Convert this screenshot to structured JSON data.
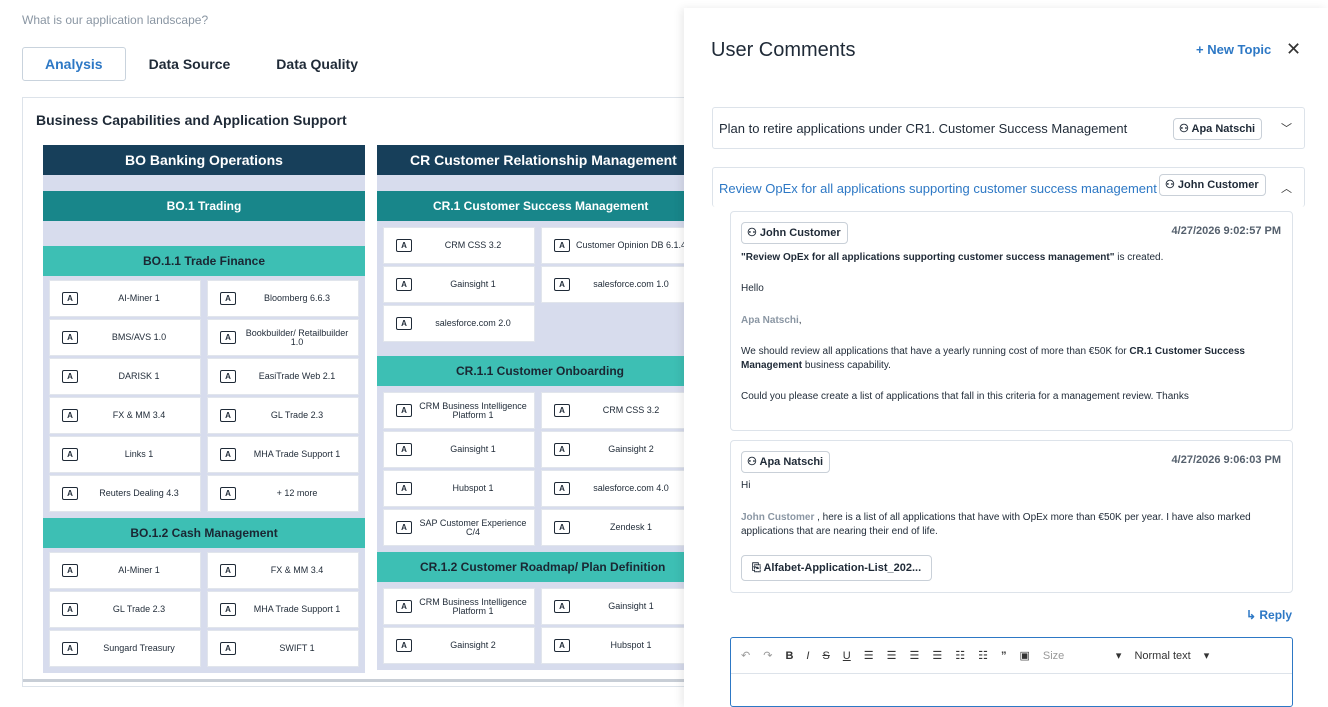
{
  "left": {
    "question": "What is our application landscape?",
    "tabs": [
      "Analysis",
      "Data Source",
      "Data Quality"
    ],
    "panel_title": "Business Capabilities and Application Support",
    "bo": {
      "title": "BO Banking Operations",
      "l2": "BO.1 Trading",
      "groups": [
        {
          "title": "BO.1.1 Trade Finance",
          "apps": [
            "AI-Miner 1",
            "Bloomberg 6.6.3",
            "BMS/AVS 1.0",
            "Bookbuilder/ Retailbuilder 1.0",
            "DARISK 1",
            "EasiTrade Web 2.1",
            "FX & MM 3.4",
            "GL Trade 2.3",
            "Links 1",
            "MHA Trade Support 1",
            "Reuters Dealing 4.3",
            "+ 12 more"
          ]
        },
        {
          "title": "BO.1.2 Cash Management",
          "apps": [
            "AI-Miner 1",
            "FX & MM 3.4",
            "GL Trade 2.3",
            "MHA Trade Support 1",
            "Sungard Treasury",
            "SWIFT 1"
          ]
        }
      ]
    },
    "cr": {
      "title": "CR Customer Relationship Management",
      "l2": "CR.1 Customer Success Management",
      "l2_apps": [
        "CRM CSS 3.2",
        "Customer Opinion DB 6.1.4",
        "Gainsight 1",
        "salesforce.com 1.0",
        "salesforce.com 2.0"
      ],
      "groups": [
        {
          "title": "CR.1.1 Customer Onboarding",
          "apps": [
            "CRM Business Intelligence Platform 1",
            "CRM CSS 3.2",
            "Gainsight 1",
            "Gainsight 2",
            "Hubspot 1",
            "salesforce.com 4.0",
            "SAP Customer Experience C/4",
            "Zendesk 1"
          ]
        },
        {
          "title": "CR.1.2 Customer Roadmap/ Plan Definition",
          "apps": [
            "CRM Business Intelligence Platform 1",
            "Gainsight 1",
            "Gainsight 2",
            "Hubspot 1"
          ]
        }
      ]
    }
  },
  "right": {
    "title": "User Comments",
    "new_topic": "+ New Topic",
    "close": "✕",
    "topic1": {
      "title": "Plan to retire applications under CR1. Customer Success Management",
      "user": "Apa Natschi"
    },
    "topic2": {
      "title": "Review OpEx for all applications supporting customer success management",
      "user": "John Customer"
    },
    "comment1": {
      "user": "John Customer",
      "date": "4/27/2026 9:02:57 PM",
      "created_quote": "\"Review OpEx for all applications supporting customer success management\"",
      "created_suffix": " is created.",
      "hello": "Hello",
      "mention": "Apa Natschi",
      "mention_suffix": ",",
      "p1a": "We should review all applications that have a yearly running cost of more than €50K for ",
      "p1b": "CR.1 Customer Success Management",
      "p1c": " business capability.",
      "p2": "Could you please create a list of applications that fall in this criteria for a management review. Thanks"
    },
    "comment2": {
      "user": "Apa Natschi",
      "date": "4/27/2026 9:06:03 PM",
      "hi": "Hi",
      "mention": "John Customer",
      "text": " , here is a list of all applications that have with OpEx more than €50K per year. I have also marked applications that are nearing their end of life.",
      "attachment": "Alfabet-Application-List_202..."
    },
    "reply": "Reply",
    "editor": {
      "size": "Size",
      "format": "Normal text"
    }
  }
}
